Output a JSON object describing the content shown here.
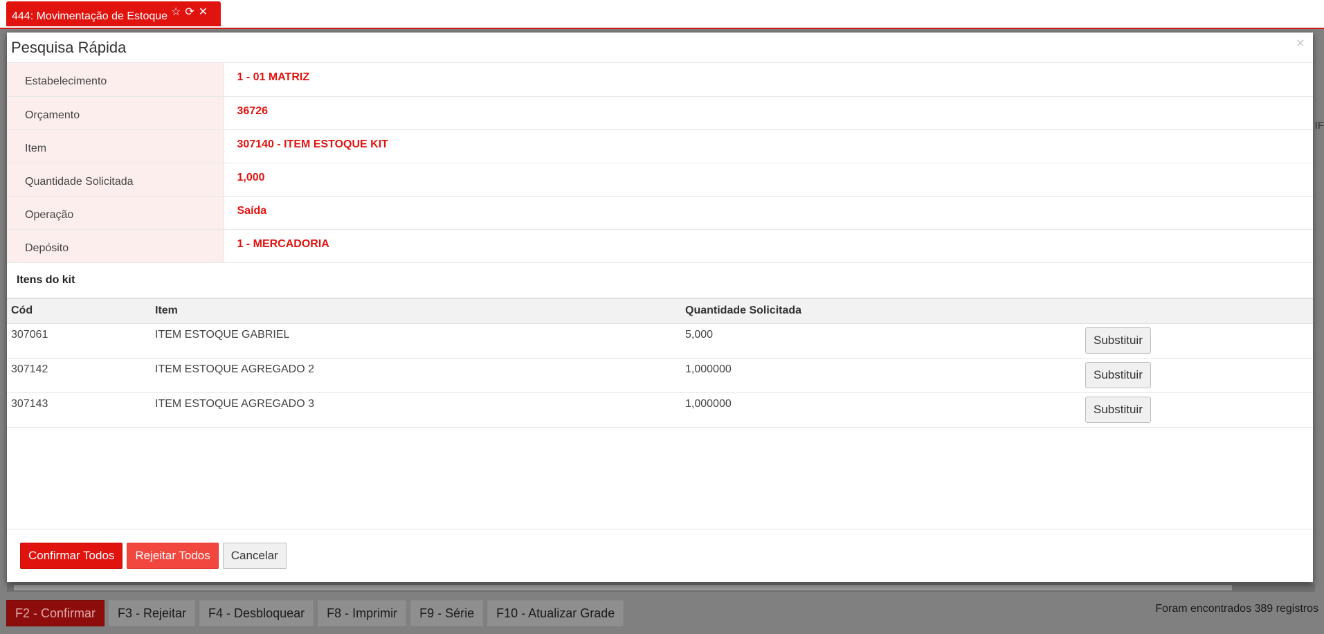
{
  "app_tab": {
    "title": "444: Movimentação de Estoque",
    "star_icon": "☆",
    "refresh_icon": "⟳",
    "close_icon": "✕"
  },
  "background": {
    "edge_text": "IF",
    "records_text": "Foram encontrados 389 registros",
    "function_keys": [
      "F2 - Confirmar",
      "F3 - Rejeitar",
      "F4 - Desbloquear",
      "F8 - Imprimir",
      "F9 - Série",
      "F10 - Atualizar Grade"
    ]
  },
  "modal": {
    "title": "Pesquisa Rápida",
    "close_symbol": "×",
    "fields": [
      {
        "label": "Estabelecimento",
        "value": "1 - 01 MATRIZ"
      },
      {
        "label": "Orçamento",
        "value": "36726"
      },
      {
        "label": "Item",
        "value": "307140 - ITEM ESTOQUE KIT"
      },
      {
        "label": "Quantidade Solicitada",
        "value": "1,000"
      },
      {
        "label": "Operação",
        "value": "Saída"
      },
      {
        "label": "Depósito",
        "value": "1 - MERCADORIA"
      }
    ],
    "kit_title": "Itens do kit",
    "kit_columns": [
      "Cód",
      "Item",
      "Quantidade Solicitada"
    ],
    "kit_rows": [
      {
        "cod": "307061",
        "item": "ITEM ESTOQUE GABRIEL",
        "qty": "5,000",
        "action": "Substituir"
      },
      {
        "cod": "307142",
        "item": "ITEM ESTOQUE AGREGADO 2",
        "qty": "1,000000",
        "action": "Substituir"
      },
      {
        "cod": "307143",
        "item": "ITEM ESTOQUE AGREGADO 3",
        "qty": "1,000000",
        "action": "Substituir"
      }
    ],
    "footer": {
      "confirm_all": "Confirmar Todos",
      "reject_all": "Rejeitar Todos",
      "cancel": "Cancelar"
    }
  },
  "colors": {
    "brand_red": "#e0130f",
    "label_bg": "#fdeeee"
  }
}
